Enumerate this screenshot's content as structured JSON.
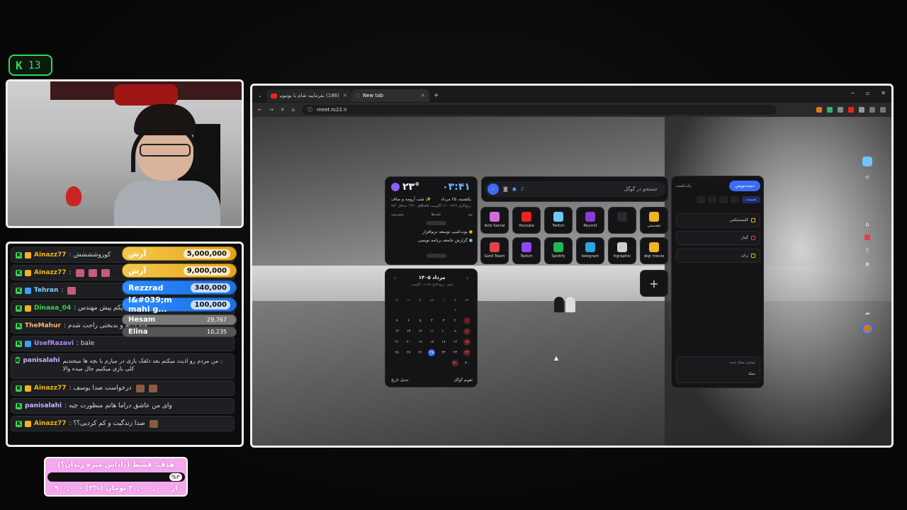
{
  "kick": {
    "letter": "K",
    "count": "13"
  },
  "chat": {
    "messages": [
      {
        "user": "Ainazz77",
        "color": "#f2b41c",
        "text": ": کوروشششش",
        "badge": "gold"
      },
      {
        "user": "Ainazz77",
        "color": "#f2b41c",
        "text": ":",
        "badge": "gold",
        "emotes": 3
      },
      {
        "user": "Tehran",
        "color": "#7fd3ff",
        "text": ":",
        "badge": "blue",
        "emotes": 1
      },
      {
        "user": "Dinaaa_04",
        "color": "#39d353",
        "text": ": من برم پکم پیش مهندس",
        "badge": "gold"
      },
      {
        "user": "TheMahur",
        "color": "#ffb66b",
        "text": ": منه درام و بدبختی راحت شدم",
        "badge": ""
      },
      {
        "user": "UsefRazavi",
        "color": "#b58cff",
        "text": ": bale",
        "badge": "blue"
      },
      {
        "user": "panisalahi",
        "color": "#c9b6ff",
        "text": ": من مردم رو اذیت میکنم بعد دلقک بازی در میارم با بچه ها میخندیم کلی بازی میکنیم حال میده والا",
        "badge": ""
      },
      {
        "user": "Ainazz77",
        "color": "#f2b41c",
        "text": ": درخواست صدا یوسف",
        "badge": "gold",
        "emotes": 2
      },
      {
        "user": "panisalahi",
        "color": "#c9b6ff",
        "text": ": وای من عاشق دراما هاتم منظورت چیه",
        "badge": ""
      },
      {
        "user": "Ainazz77",
        "color": "#f2b41c",
        "text": ": صدا زندگیت و کم کردیی؟؟",
        "badge": "gold",
        "emotes": 1
      }
    ]
  },
  "tips": [
    {
      "name": "آرش",
      "amount": "5,000,000",
      "style": "gold"
    },
    {
      "name": "آرش",
      "amount": "9,000,000",
      "style": "gold"
    },
    {
      "name": "Rezzrad",
      "amount": "340,000",
      "style": "blue"
    },
    {
      "name": "I&#039;m mahi g...",
      "amount": "100,000",
      "style": "blue"
    },
    {
      "name": "Hesam",
      "amount": "29,767",
      "style": "grey"
    },
    {
      "name": "Elina",
      "amount": "10,235",
      "style": "dgrey"
    }
  ],
  "goal": {
    "title": "هدف: قسط (داداش میره زندان؟)",
    "pct": "%۳",
    "progress": 0.03,
    "subtitle": "۹۰۰,۰۰۰ از ۳۰,۰۰۰,۰۰۰ تومان (%۳)"
  },
  "browser": {
    "tab1": "(186) بفرمایید شام با یوتیوبرا (مـ...",
    "tab2": "New tab",
    "url": "meet.ts22.ir",
    "widgets": {
      "time": "۰۳:۴۱",
      "temp": "۲۳°",
      "date": "یکشنبه، ۲۵ مرداد",
      "weather": "شب آرومه و صاف ✨",
      "date_sub": "۹ ربیع‌الاول ۱۴۴۷ - ۱۶ آگوست ۲۰۲۵",
      "weather_sub": "۲۵° حداکثر - ۲۳° حداقل",
      "pill_left": "پیش‌بینی",
      "pill_mid": "تیم",
      "pill_right": "تیلت‌ها",
      "todo1": "بوت‌کمپ توسعه نرم‌افزار",
      "todo2": "گزارش جامعه برنامه نویسی",
      "search_ph": "جستجو در گوگل",
      "shortcuts": [
        {
          "label": "دهدستی",
          "color": "#f2b41c"
        },
        {
          "label": "",
          "color": "#2a2a2e"
        },
        {
          "label": "Reymit",
          "color": "#8b3bd6"
        },
        {
          "label": "Twitch",
          "color": "#6ec6ff"
        },
        {
          "label": "Youtube",
          "color": "#e22"
        },
        {
          "label": "Anti Social",
          "color": "#d46bd6"
        },
        {
          "label": "digi movie",
          "color": "#f2b41c"
        },
        {
          "label": "tlgraphic",
          "color": "#cfcfcf"
        },
        {
          "label": "telegram",
          "color": "#2aa3e0"
        },
        {
          "label": "Spotify",
          "color": "#1db954"
        },
        {
          "label": "Twitch",
          "color": "#9146ff"
        },
        {
          "label": "Gold Team",
          "color": "#e24343"
        }
      ],
      "cal_title": "مرداد ۱۴۰۵",
      "cal_sub": "صفر - ربیع الاول  ۲۰۲۵ - آگوست",
      "cal_days": [
        "ش",
        "ی",
        "د",
        "س",
        "چ",
        "پ",
        "ج"
      ],
      "cal_left": "تبدیل تاریخ",
      "cal_right": "تقویم گوگل",
      "notes_tab_on": "دست‌نویس",
      "notes_tab_off": "یادداشت",
      "notes_filter": "همیشه",
      "notes": [
        {
          "label": "کلیستنیکس",
          "color": "#f2b41c"
        },
        {
          "label": "گیتار",
          "color": "#e24343"
        },
        {
          "label": "زبان",
          "color": "#f2b41c"
        }
      ],
      "new_note": "نوشتن تسک جدید",
      "new_note_btn": "تسک"
    }
  }
}
